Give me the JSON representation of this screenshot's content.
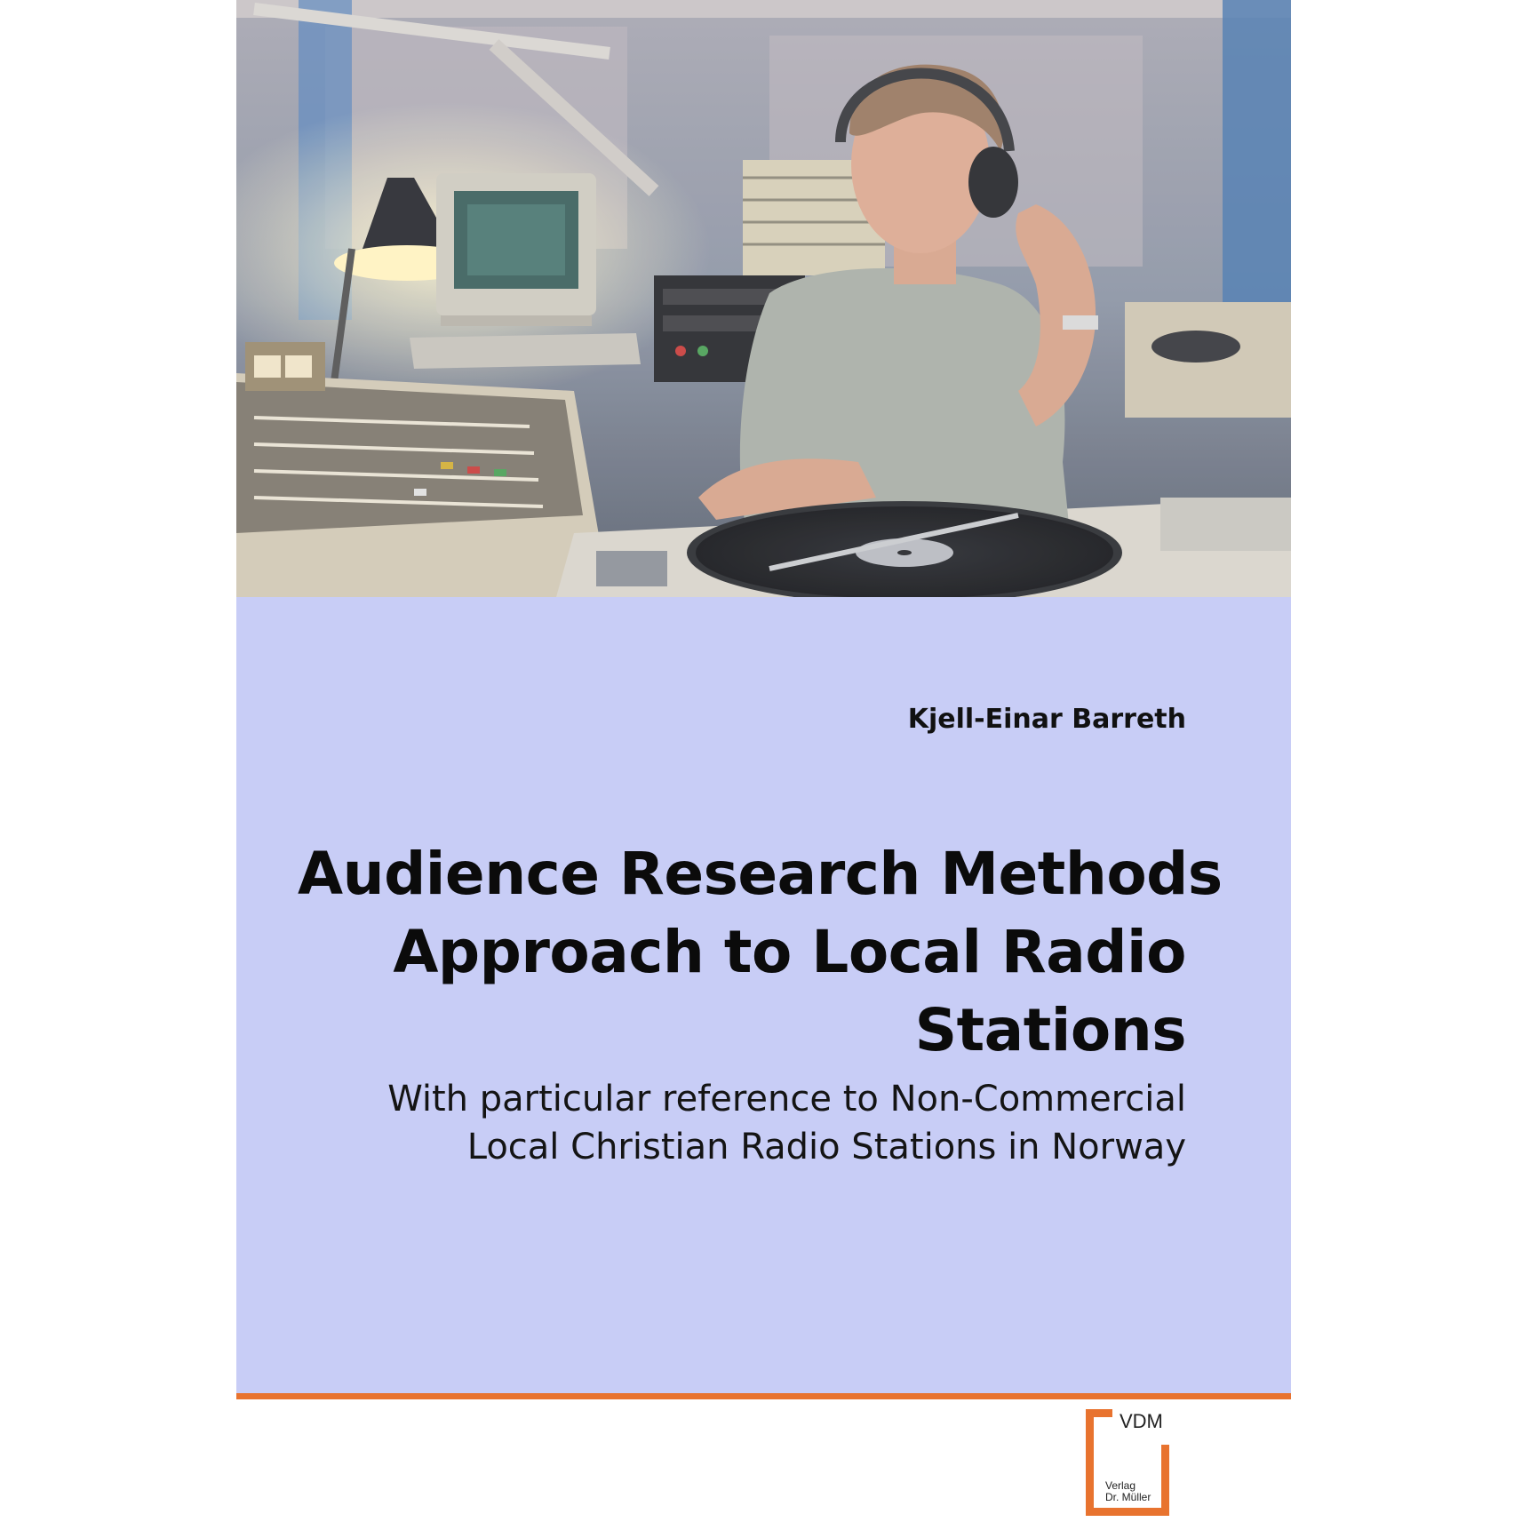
{
  "book": {
    "author": "Kjell-Einar Barreth",
    "title_lines": [
      "Audience Research Methods",
      "Approach to Local Radio",
      "Stations"
    ],
    "subtitle_lines": [
      "With particular reference to Non-Commercial",
      "Local Christian Radio Stations in Norway"
    ]
  },
  "publisher": {
    "brand": "VDM",
    "line1": "Verlag",
    "line2": "Dr. Müller"
  },
  "colors": {
    "panel": "#c8cdf6",
    "accent": "#e8732f"
  }
}
